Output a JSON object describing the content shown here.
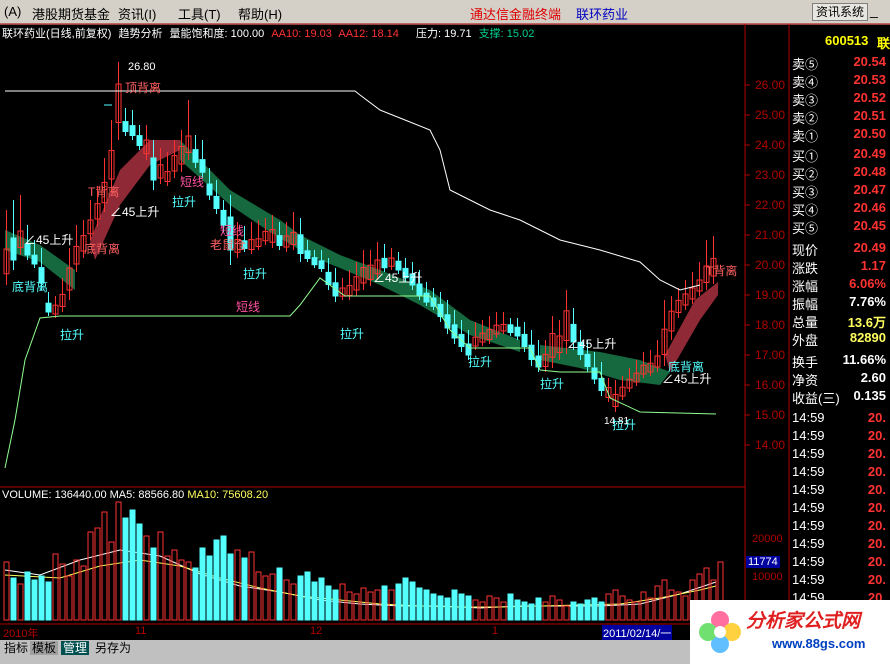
{
  "menubar": {
    "sys_label": "(A)",
    "items": [
      "港股期货基金",
      "资讯(I)",
      "工具(T)",
      "帮助(H)"
    ],
    "center_title": "通达信金融终端",
    "stock_name": "联环药业",
    "sys_button": "资讯系统",
    "window_buttons": [
      "_",
      "□",
      "×"
    ]
  },
  "infobar": {
    "title": "联环药业(日线,前复权)",
    "indicator": "趋势分析",
    "energy": "量能饱和度: 100.00",
    "aa10": "AA10: 19.03",
    "aa12": "AA12: 18.14",
    "pressure": "压力: 19.71",
    "support": "支撑: 15.02"
  },
  "price_axis": [
    "26.00",
    "25.00",
    "24.00",
    "23.00",
    "22.00",
    "21.00",
    "20.00",
    "19.00",
    "18.00",
    "17.00",
    "16.00",
    "15.00",
    "14.00"
  ],
  "volume_axis": [
    "20000",
    "11774",
    "10000"
  ],
  "date_axis": [
    "2010年",
    "11",
    "12",
    "1",
    "2011/02/14/一"
  ],
  "chart_labels": {
    "high": "26.80",
    "low": "14.81",
    "top_divergence": "顶背离",
    "bottom_divergence": "底背离",
    "rise45": "∠45上升",
    "pull_up": "拉升",
    "short_line": "短线",
    "old_line": "老鼠仓",
    "t_divergence": "T背离"
  },
  "volume_info": {
    "volume": "VOLUME: 136440.00",
    "ma5": "MA5: 88566.80",
    "ma10": "MA10: 75608.20"
  },
  "quote": {
    "code": "600513",
    "code_suffix": "联",
    "sells": [
      {
        "label": "卖⑤",
        "value": "20.54"
      },
      {
        "label": "卖④",
        "value": "20.53"
      },
      {
        "label": "卖③",
        "value": "20.52"
      },
      {
        "label": "卖②",
        "value": "20.51"
      },
      {
        "label": "卖①",
        "value": "20.50"
      }
    ],
    "buys": [
      {
        "label": "买①",
        "value": "20.49"
      },
      {
        "label": "买②",
        "value": "20.48"
      },
      {
        "label": "买③",
        "value": "20.47"
      },
      {
        "label": "买④",
        "value": "20.46"
      },
      {
        "label": "买⑤",
        "value": "20.45"
      }
    ],
    "stats": [
      {
        "label": "现价",
        "value": "20.49"
      },
      {
        "label": "涨跌",
        "value": "1.17"
      },
      {
        "label": "涨幅",
        "value": "6.06%"
      },
      {
        "label": "振幅",
        "value": "7.76%"
      },
      {
        "label": "总量",
        "value": "13.6万"
      },
      {
        "label": "外盘",
        "value": "82890"
      }
    ],
    "stats2": [
      {
        "label": "换手",
        "value": "11.66%"
      },
      {
        "label": "净资",
        "value": "2.60"
      },
      {
        "label": "收益(三)",
        "value": "0.135"
      }
    ],
    "ticks": [
      {
        "time": "14:59",
        "price": "20."
      },
      {
        "time": "14:59",
        "price": "20."
      },
      {
        "time": "14:59",
        "price": "20."
      },
      {
        "time": "14:59",
        "price": "20."
      },
      {
        "time": "14:59",
        "price": "20."
      },
      {
        "time": "14:59",
        "price": "20."
      },
      {
        "time": "14:59",
        "price": "20."
      },
      {
        "time": "14:59",
        "price": "20."
      },
      {
        "time": "14:59",
        "price": "20."
      },
      {
        "time": "14:59",
        "price": "20."
      },
      {
        "time": "14:59",
        "price": "20."
      },
      {
        "time": "14:59",
        "price": "20."
      }
    ]
  },
  "bottom_tabs": [
    "指标",
    "模板",
    "管理",
    "另存为"
  ],
  "watermark": {
    "title": "分析家公式网",
    "url": "www.88gs.com"
  },
  "colors": {
    "up": "#ff3232",
    "down": "#54ffff",
    "bg": "#000000",
    "axis": "#b00000",
    "green_band": "#1a7a4a",
    "red_band": "#a83040"
  }
}
